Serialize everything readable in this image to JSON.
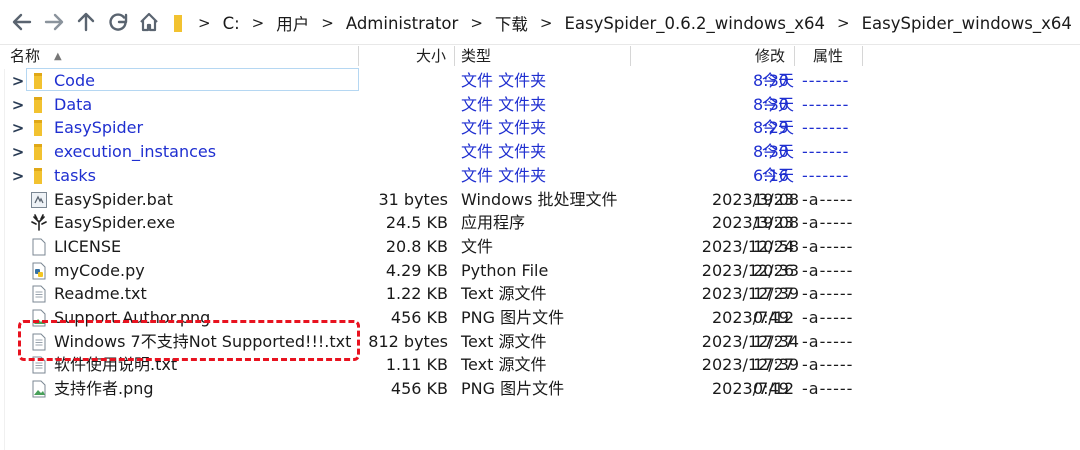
{
  "address": {
    "crumbs": [
      "C:",
      "用户",
      "Administrator",
      "下载",
      "EasySpider_0.6.2_windows_x64",
      "EasySpider_windows_x64"
    ]
  },
  "columns": {
    "name": "名称",
    "size": "大小",
    "type": "类型",
    "modified": "修改",
    "attr": "属性"
  },
  "files": [
    {
      "name": "Code",
      "size": "",
      "type": "文件 文件夹",
      "date": "今天",
      "time": "8:30",
      "attr": "-------",
      "kind": "folder"
    },
    {
      "name": "Data",
      "size": "",
      "type": "文件 文件夹",
      "date": "今天",
      "time": "8:30",
      "attr": "-------",
      "kind": "folder"
    },
    {
      "name": "EasySpider",
      "size": "",
      "type": "文件 文件夹",
      "date": "今天",
      "time": "8:29",
      "attr": "-------",
      "kind": "folder"
    },
    {
      "name": "execution_instances",
      "size": "",
      "type": "文件 文件夹",
      "date": "今天",
      "time": "8:30",
      "attr": "-------",
      "kind": "folder"
    },
    {
      "name": "tasks",
      "size": "",
      "type": "文件 文件夹",
      "date": "今天",
      "time": "6:16",
      "attr": "-------",
      "kind": "folder"
    },
    {
      "name": "EasySpider.bat",
      "size": "31 bytes",
      "type": "Windows 批处理文件",
      "date": "2023/3/23",
      "time": "19:08",
      "attr": "-a-----",
      "kind": "bat"
    },
    {
      "name": "EasySpider.exe",
      "size": "24.5 KB",
      "type": "应用程序",
      "date": "2023/3/23",
      "time": "19:08",
      "attr": "-a-----",
      "kind": "exe"
    },
    {
      "name": "LICENSE",
      "size": "20.8 KB",
      "type": "文件",
      "date": "2023/12/24",
      "time": "10:58",
      "attr": "-a-----",
      "kind": "file"
    },
    {
      "name": "myCode.py",
      "size": "4.29 KB",
      "type": "Python File",
      "date": "2023/12/26",
      "time": "20:33",
      "attr": "-a-----",
      "kind": "py"
    },
    {
      "name": "Readme.txt",
      "size": "1.22 KB",
      "type": "Text 源文件",
      "date": "2023/12/27",
      "time": "17:39",
      "attr": "-a-----",
      "kind": "txt"
    },
    {
      "name": "Support Author.png",
      "size": "456 KB",
      "type": "PNG 图片文件",
      "date": "2023/7/12",
      "time": "0:49",
      "attr": "-a-----",
      "kind": "png"
    },
    {
      "name": "Windows 7不支持Not Supported!!!.txt",
      "size": "812 bytes",
      "type": "Text 源文件",
      "date": "2023/12/27",
      "time": "17:34",
      "attr": "-a-----",
      "kind": "txt"
    },
    {
      "name": "软件使用说明.txt",
      "size": "1.11 KB",
      "type": "Text 源文件",
      "date": "2023/12/27",
      "time": "17:39",
      "attr": "-a-----",
      "kind": "txt"
    },
    {
      "name": "支持作者.png",
      "size": "456 KB",
      "type": "PNG 图片文件",
      "date": "2023/7/12",
      "time": "0:49",
      "attr": "-a-----",
      "kind": "png"
    }
  ],
  "colors": {
    "folder_text": "#1f2fd0",
    "highlight": "#e8121f",
    "folder_icon": "#f2c230"
  },
  "icons": {
    "back": "arrow-left-icon",
    "forward": "arrow-right-icon",
    "up": "arrow-up-icon",
    "refresh": "refresh-icon",
    "home": "home-icon"
  }
}
